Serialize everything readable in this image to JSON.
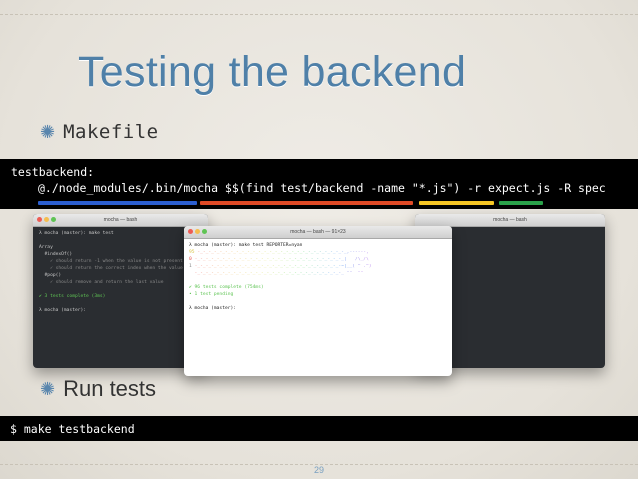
{
  "slide": {
    "title": "Testing the backend",
    "bullets": [
      "Makefile",
      "Run tests"
    ],
    "page_number": "29"
  },
  "code": {
    "makefile_target": "testbackend:",
    "makefile_command": "@./node_modules/.bin/mocha $$(find test/backend -name \"*.js\") -r expect.js -R spec",
    "run_command": "$ make testbackend"
  },
  "terminals": {
    "back": {
      "title": "mocha — bash",
      "lines": [
        "λ mocha (master): make test",
        "",
        "Array",
        "  #indexOf()",
        "    ✓ should return -1 when the value is not present",
        "    ✓ should return the correct index when the value is",
        "  #pop()",
        "    ✓ should remove and return the last value",
        "",
        "✔ 3 tests complete (3ms)",
        "",
        "λ mocha (master): "
      ]
    },
    "front": {
      "title": "mocha — bash — 91×23",
      "command": "λ mocha (master): make test REPORTER=nyan",
      "lines": [
        "95",
        "0",
        "1"
      ],
      "complete": "✔ 96 tests complete (754ms)",
      "pending": "• 1 test pending",
      "prompt": "λ mocha (master): "
    },
    "right": {
      "title": "mocha — bash"
    }
  },
  "colors": {
    "title": "#4f80a8",
    "underline_blue": "#2c5fd0",
    "underline_red": "#e04a26",
    "underline_yellow": "#f6c624",
    "underline_green": "#2aa24a"
  }
}
